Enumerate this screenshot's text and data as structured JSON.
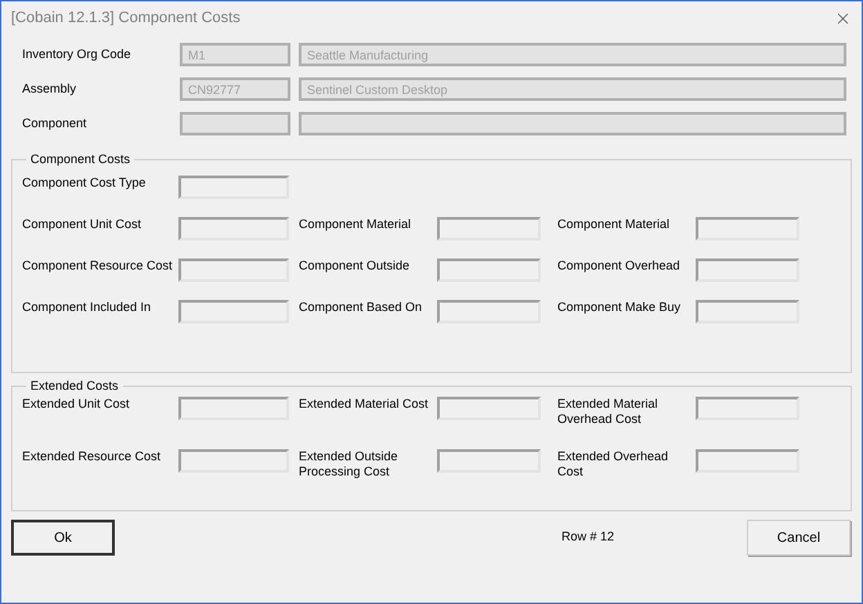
{
  "window": {
    "title": "[Cobain 12.1.3] Component Costs"
  },
  "header_fields": [
    {
      "label": "Inventory Org Code",
      "code": "M1",
      "name": "Seattle Manufacturing",
      "disabled": true
    },
    {
      "label": "Assembly",
      "code": "CN92777",
      "name": "Sentinel Custom Desktop",
      "disabled": true
    },
    {
      "label": "Component",
      "disabled": true
    }
  ],
  "groups": [
    {
      "title": "Component Costs",
      "rows": [
        [
          {
            "label": "Component Cost Type",
            "disabled": false
          }
        ],
        [
          {
            "label": "Component Unit Cost",
            "disabled": false
          },
          {
            "label": "Component Material",
            "disabled": false
          },
          {
            "label": "Component Material",
            "disabled": false
          }
        ],
        [
          {
            "label": "Component Resource Cost",
            "disabled": false
          },
          {
            "label": "Component Outside",
            "disabled": false
          },
          {
            "label": "Component Overhead",
            "disabled": false
          }
        ],
        [
          {
            "label": "Component Included In",
            "disabled": false
          },
          {
            "label": "Component Based On",
            "disabled": false
          },
          {
            "label": "Component Make Buy",
            "disabled": false
          }
        ]
      ]
    },
    {
      "title": "Extended Costs",
      "rows": [
        [
          {
            "label": "Extended Unit Cost",
            "disabled": false
          },
          {
            "label": "Extended Material Cost",
            "disabled": false
          },
          {
            "label": "Extended Material Overhead Cost",
            "disabled": false
          }
        ],
        [
          {
            "label": "Extended Resource Cost",
            "disabled": false
          },
          {
            "label": "Extended Outside Processing Cost",
            "disabled": false
          },
          {
            "label": "Extended Overhead Cost",
            "disabled": false
          }
        ]
      ]
    }
  ],
  "footer": {
    "ok": {
      "label": "Ok",
      "focused": true
    },
    "row": "Row # 12",
    "cancel": {
      "label": "Cancel",
      "focused": false
    }
  }
}
